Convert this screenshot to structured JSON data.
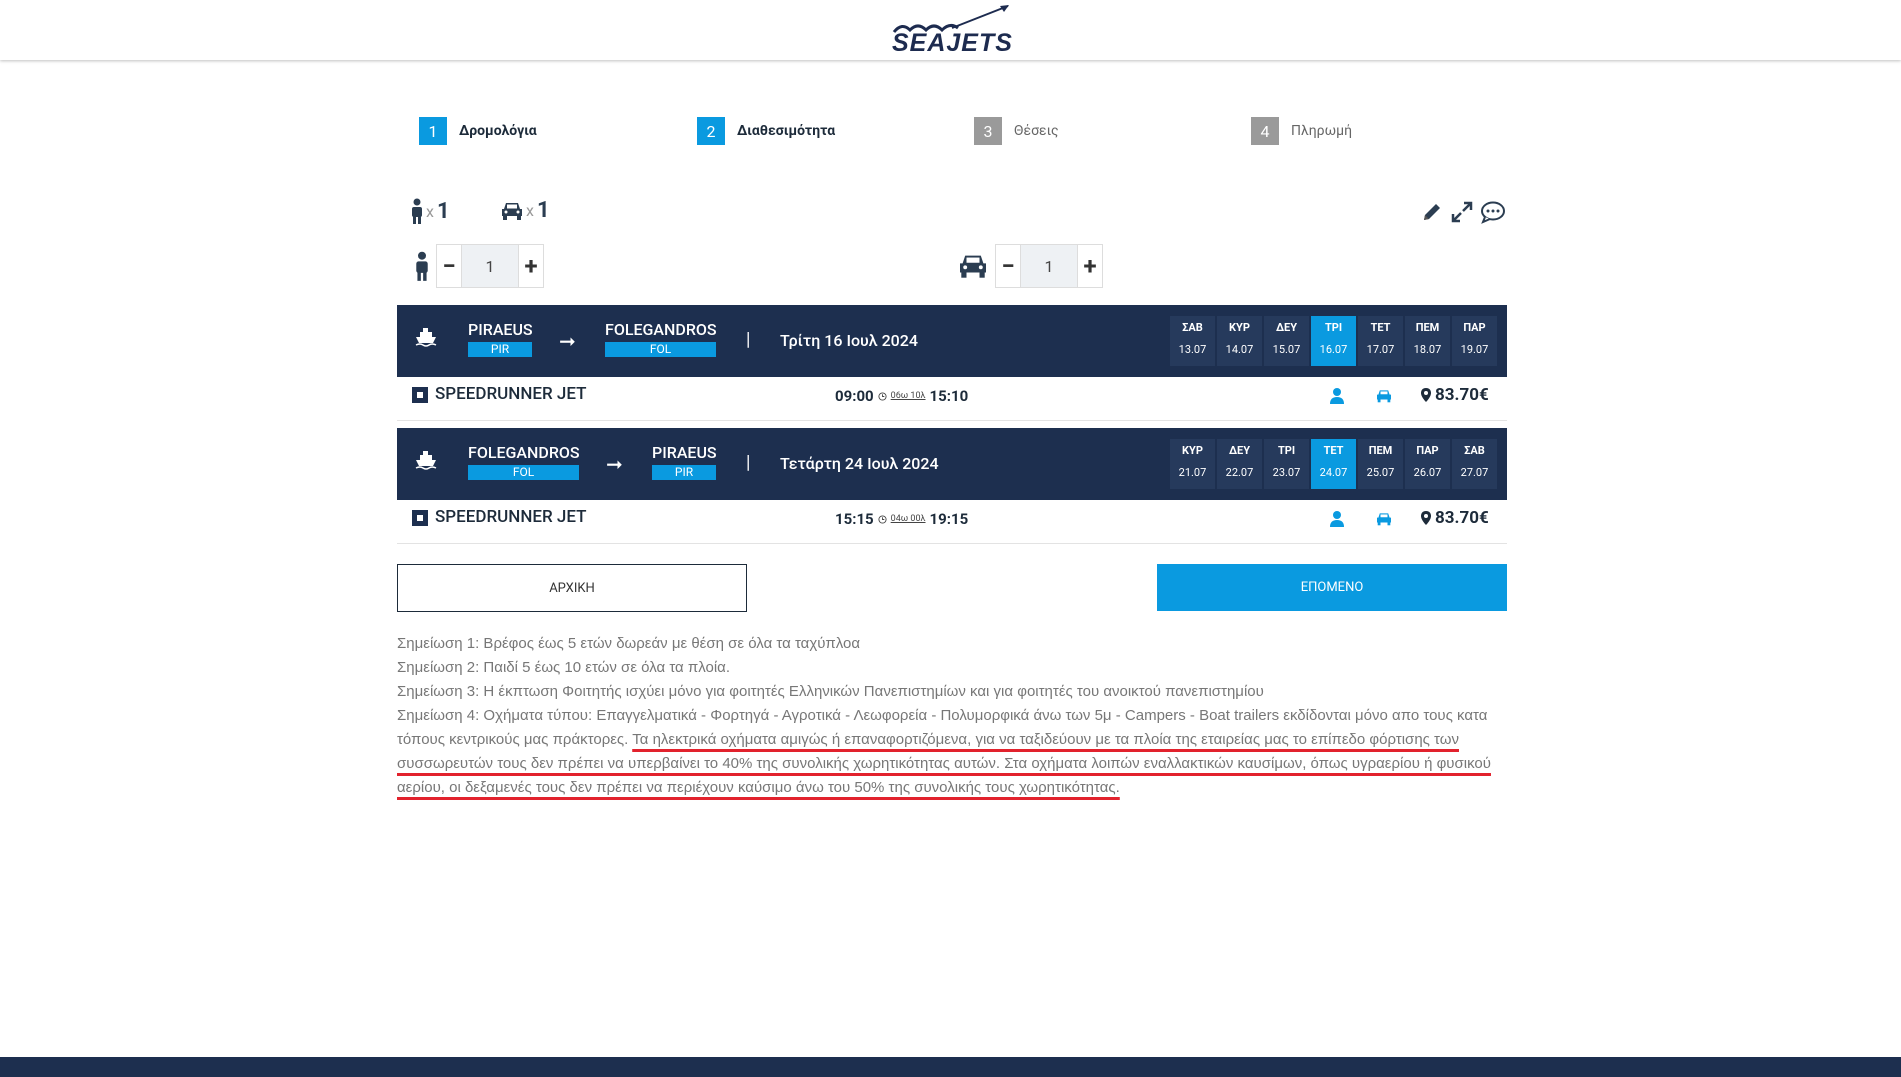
{
  "brand": {
    "logo_text": "SEAJETS"
  },
  "steps": [
    {
      "num": "1",
      "label": "Δρομολόγια",
      "state": "active"
    },
    {
      "num": "2",
      "label": "Διαθεσιμότητα",
      "state": "active"
    },
    {
      "num": "3",
      "label": "Θέσεις",
      "state": "inactive"
    },
    {
      "num": "4",
      "label": "Πληρωμή",
      "state": "inactive"
    }
  ],
  "summary": {
    "passengers_x": "x",
    "passengers": "1",
    "vehicles_x": "x",
    "vehicles": "1"
  },
  "steppers": {
    "passengers_value": "1",
    "vehicles_value": "1",
    "minus": "−",
    "plus": "+"
  },
  "outbound": {
    "from_name": "PIRAEUS",
    "from_code": "PIR",
    "to_name": "FOLEGANDROS",
    "to_code": "FOL",
    "arrow": "➞",
    "sep": "|",
    "date": "Τρίτη 16 Ιουλ 2024",
    "days": [
      {
        "name": "ΣΑΒ",
        "date": "13.07",
        "selected": false
      },
      {
        "name": "ΚΥΡ",
        "date": "14.07",
        "selected": false
      },
      {
        "name": "ΔΕΥ",
        "date": "15.07",
        "selected": false
      },
      {
        "name": "ΤΡΙ",
        "date": "16.07",
        "selected": true
      },
      {
        "name": "ΤΕΤ",
        "date": "17.07",
        "selected": false
      },
      {
        "name": "ΠΕΜ",
        "date": "18.07",
        "selected": false
      },
      {
        "name": "ΠΑΡ",
        "date": "19.07",
        "selected": false
      }
    ],
    "trip": {
      "vessel": "SPEEDRUNNER JET",
      "depart": "09:00",
      "duration": "06ω 10λ",
      "arrive": "15:10",
      "price": "83.70€"
    }
  },
  "return": {
    "from_name": "FOLEGANDROS",
    "from_code": "FOL",
    "to_name": "PIRAEUS",
    "to_code": "PIR",
    "arrow": "➞",
    "sep": "|",
    "date": "Τετάρτη 24 Ιουλ 2024",
    "days": [
      {
        "name": "ΚΥΡ",
        "date": "21.07",
        "selected": false
      },
      {
        "name": "ΔΕΥ",
        "date": "22.07",
        "selected": false
      },
      {
        "name": "ΤΡΙ",
        "date": "23.07",
        "selected": false
      },
      {
        "name": "ΤΕΤ",
        "date": "24.07",
        "selected": true
      },
      {
        "name": "ΠΕΜ",
        "date": "25.07",
        "selected": false
      },
      {
        "name": "ΠΑΡ",
        "date": "26.07",
        "selected": false
      },
      {
        "name": "ΣΑΒ",
        "date": "27.07",
        "selected": false
      }
    ],
    "trip": {
      "vessel": "SPEEDRUNNER JET",
      "depart": "15:15",
      "duration": "04ω 00λ",
      "arrive": "19:15",
      "price": "83.70€"
    }
  },
  "buttons": {
    "home": "ΑΡΧΙΚΗ",
    "next": "ΕΠΟΜΕΝΟ"
  },
  "notes": {
    "n1": "Σημείωση 1: Βρέφος έως 5 ετών δωρεάν με θέση σε όλα τα ταχύπλοα",
    "n2": "Σημείωση 2: Παιδί 5 έως 10 ετών σε όλα τα πλοία.",
    "n3": "Σημείωση 3: Η έκπτωση Φοιτητής ισχύει μόνο για φοιτητές Ελληνικών Πανεπιστημίων και για φοιτητές του ανοικτού πανεπιστημίου",
    "n4_plain": "Σημείωση 4: Οχήματα τύπου: Επαγγελματικά - Φορτηγά - Αγροτικά - Λεωφορεία - Πολυμορφικά άνω των 5μ - Campers - Boat trailers εκδίδονται μόνο απο τους κατα τόπους κεντρικούς μας πράκτορες.",
    "n4_highlight": "Τα ηλεκτρικά οχήματα αμιγώς ή επαναφορτιζόμενα, για να ταξιδεύουν με τα πλοία της εταιρείας μας το επίπεδο φόρτισης των συσσωρευτών τους δεν πρέπει να υπερβαίνει το 40% της συνολικής χωρητικότητας αυτών. Στα οχήματα λοιπών εναλλακτικών καυσίμων, όπως υγραερίου ή φυσικού αερίου, οι δεξαμενές τους δεν πρέπει να περιέχουν καύσιμο άνω του 50% της συνολικής τους χωρητικότητας."
  },
  "colors": {
    "navy": "#1d2f4f",
    "accent": "#0a9ae0",
    "inactive": "#9a9a9a",
    "annotation": "#e2222d"
  },
  "icons": [
    "person-icon",
    "car-icon",
    "pencil-icon",
    "expand-icon",
    "chat-icon",
    "ship-icon",
    "arrow-right-icon",
    "clock-icon",
    "map-pin-icon",
    "checkbox-icon"
  ]
}
